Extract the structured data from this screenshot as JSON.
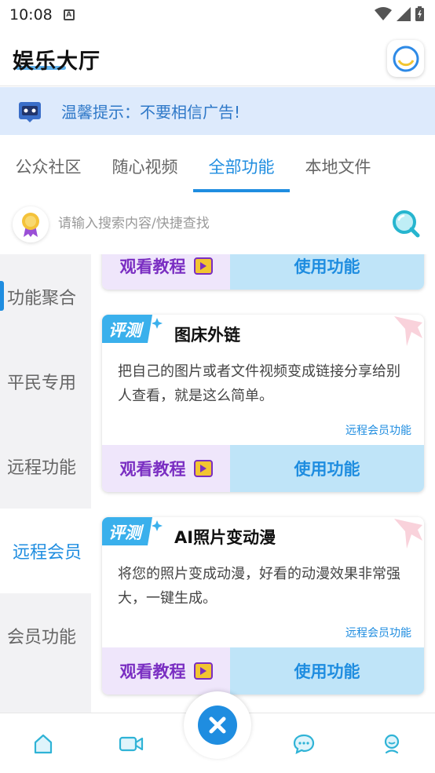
{
  "status": {
    "time": "10:08"
  },
  "header": {
    "title": "娱乐大厅"
  },
  "notice": {
    "text": "温馨提示：不要相信广告!"
  },
  "tabs": [
    {
      "label": "公众社区",
      "active": false
    },
    {
      "label": "随心视频",
      "active": false
    },
    {
      "label": "全部功能",
      "active": true
    },
    {
      "label": "本地文件",
      "active": false
    }
  ],
  "search": {
    "placeholder": "请输入搜索内容/快捷查找"
  },
  "sidebar": {
    "items": [
      {
        "label": "功能聚合",
        "active": false
      },
      {
        "label": "平民专用",
        "active": false
      },
      {
        "label": "远程功能",
        "active": false
      },
      {
        "label": "远程会员",
        "active": true
      },
      {
        "label": "会员功能",
        "active": false
      }
    ]
  },
  "cards": [
    {
      "title": "",
      "description": "",
      "tag": "",
      "tutorial_label": "观看教程",
      "use_label": "使用功能"
    },
    {
      "badge": "评测",
      "title": "图床外链",
      "description": "把自己的图片或者文件视频变成链接分享给别人查看，就是这么简单。",
      "tag": "远程会员功能",
      "tutorial_label": "观看教程",
      "use_label": "使用功能"
    },
    {
      "badge": "评测",
      "title": "AI照片变动漫",
      "description": "将您的照片变成动漫，好看的动漫效果非常强大，一键生成。",
      "tag": "远程会员功能",
      "tutorial_label": "观看教程",
      "use_label": "使用功能"
    }
  ],
  "icons": {
    "nav": [
      "home-icon",
      "video-icon",
      "close-icon",
      "chat-icon",
      "profile-icon"
    ]
  },
  "colors": {
    "accent": "#1f8de0",
    "tutorial": "#7a2ec2",
    "notice_bg": "#ddeafc"
  }
}
